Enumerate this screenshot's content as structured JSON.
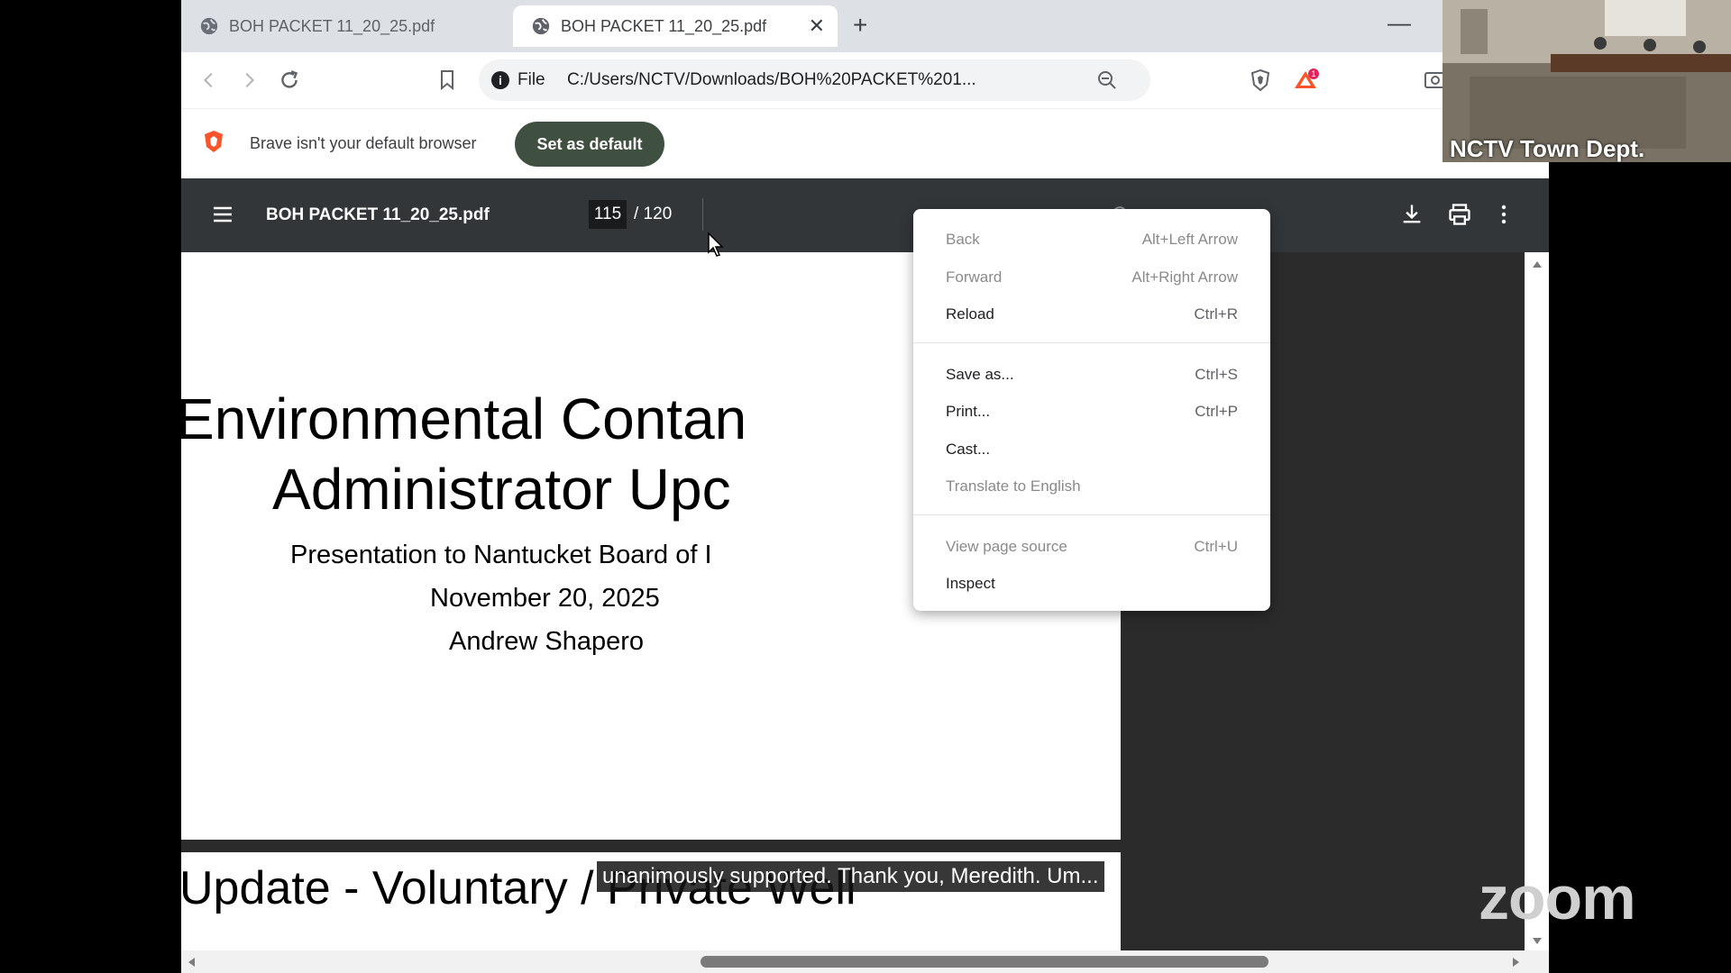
{
  "tabs": [
    {
      "title": "BOH PACKET 11_20_25.pdf"
    },
    {
      "title": "BOH PACKET 11_20_25.pdf"
    }
  ],
  "tab_close": "✕",
  "new_tab": "+",
  "window_minimize": "—",
  "address": {
    "scheme": "File",
    "url": "C:/Users/NCTV/Downloads/BOH%20PACKET%201..."
  },
  "infobar": {
    "message": "Brave isn't your default browser",
    "button": "Set as default"
  },
  "pdf": {
    "title": "BOH PACKET 11_20_25.pdf",
    "current_page": "115",
    "total_pages": "/ 120"
  },
  "slide": {
    "line1": "Environmental Contan",
    "line2": "Administrator Upc",
    "subtitle": "Presentation to Nantucket Board of I",
    "date": "November 20, 2025",
    "author": "Andrew Shapero",
    "next_title": "Update - Voluntary / Private Well"
  },
  "context_menu": [
    {
      "label": "Back",
      "shortcut": "Alt+Left Arrow",
      "disabled": true
    },
    {
      "label": "Forward",
      "shortcut": "Alt+Right Arrow",
      "disabled": true
    },
    {
      "label": "Reload",
      "shortcut": "Ctrl+R",
      "disabled": false
    },
    {
      "label": "Save as...",
      "shortcut": "Ctrl+S",
      "disabled": false
    },
    {
      "label": "Print...",
      "shortcut": "Ctrl+P",
      "disabled": false
    },
    {
      "label": "Cast...",
      "shortcut": "",
      "disabled": false
    },
    {
      "label": "Translate to English",
      "shortcut": "",
      "disabled": true
    },
    {
      "label": "View page source",
      "shortcut": "Ctrl+U",
      "disabled": true
    },
    {
      "label": "Inspect",
      "shortcut": "",
      "disabled": false
    }
  ],
  "zoom": {
    "camera_label": "NCTV Town Dept.",
    "caption": "unanimously supported. Thank you, Meredith. Um...",
    "logo": "zoom"
  },
  "icons": {
    "back": "back-arrow-icon",
    "forward": "forward-arrow-icon",
    "reload": "reload-icon",
    "bookmark": "bookmark-icon",
    "zoom_out": "zoom-out-icon",
    "brave_shield": "brave-shield-icon",
    "brave_rewards": "brave-rewards-icon",
    "rewards_badge": "1",
    "menu": "hamburger-menu-icon",
    "download": "download-icon",
    "print": "print-icon",
    "more": "more-vertical-icon",
    "rotate": "rotate-icon"
  },
  "colors": {
    "tabstrip": "#dde1e6",
    "pdf_toolbar": "#323639",
    "set_default_button": "#3f4f40",
    "brave_orange": "#fb542b"
  }
}
